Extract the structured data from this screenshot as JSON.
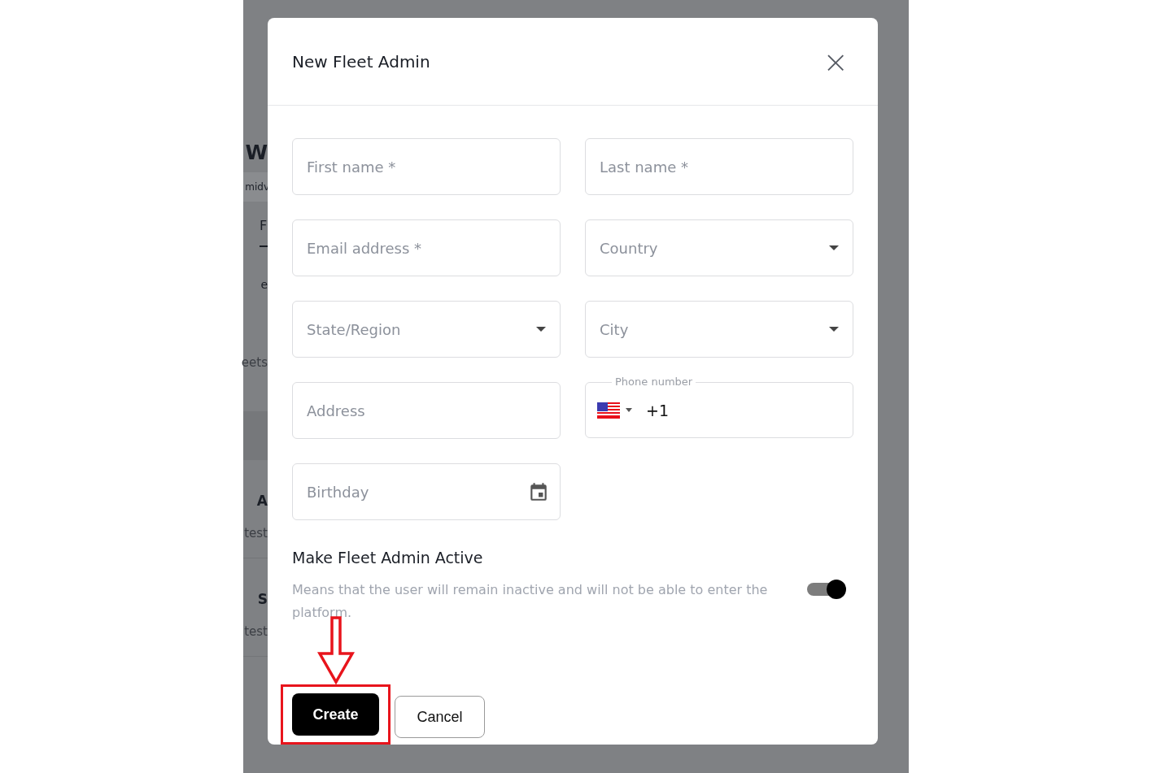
{
  "background_page": {
    "fragments": [
      {
        "kind": "heading",
        "text": "W"
      },
      {
        "kind": "subtitle",
        "text": "midv"
      },
      {
        "kind": "tab",
        "text": "F"
      },
      {
        "kind": "text",
        "text": "e"
      },
      {
        "kind": "large",
        "text": "eets"
      },
      {
        "kind": "band"
      },
      {
        "kind": "bold",
        "text": "A"
      },
      {
        "kind": "muted",
        "text": "test"
      },
      {
        "kind": "bold",
        "text": "S"
      },
      {
        "kind": "muted",
        "text": "test"
      }
    ]
  },
  "dialog": {
    "title": "New Fleet Admin",
    "close": "×",
    "fields": [
      {
        "kind": "text",
        "placeholder": "First name *"
      },
      {
        "kind": "text",
        "placeholder": "Last name *"
      },
      {
        "kind": "text",
        "placeholder": "Email address *"
      },
      {
        "kind": "select",
        "placeholder": "Country"
      },
      {
        "kind": "select",
        "placeholder": "State/Region"
      },
      {
        "kind": "select",
        "placeholder": "City"
      },
      {
        "kind": "text",
        "placeholder": "Address"
      },
      {
        "kind": "phone",
        "label": "Phone number",
        "value": "+1"
      },
      {
        "kind": "date",
        "placeholder": "Birthday"
      }
    ],
    "active": {
      "title": "Make Fleet Admin Active",
      "description": "Means that the user will remain inactive and will not be able to enter the platform.",
      "on": true
    },
    "buttons": [
      {
        "kind": "primary",
        "label": "Create",
        "highlighted": true
      },
      {
        "kind": "secondary",
        "label": "Cancel",
        "highlighted": false
      }
    ]
  }
}
